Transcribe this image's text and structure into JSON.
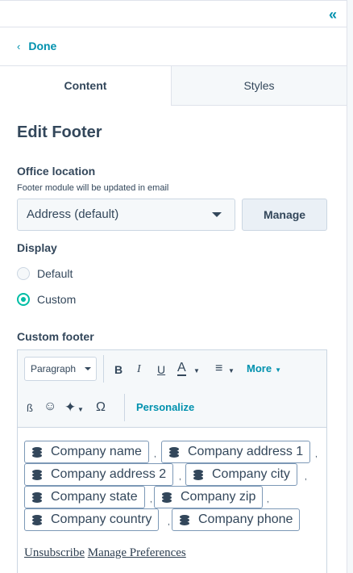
{
  "header": {
    "collapse_icon": "«"
  },
  "nav": {
    "done_label": "Done",
    "chevron": "‹"
  },
  "tabs": [
    {
      "label": "Content",
      "active": true
    },
    {
      "label": "Styles",
      "active": false
    }
  ],
  "panel": {
    "title": "Edit Footer",
    "office_location": {
      "label": "Office location",
      "help": "Footer module will be updated in email",
      "selected": "Address (default)",
      "manage_label": "Manage"
    },
    "display": {
      "label": "Display",
      "options": [
        {
          "label": "Default",
          "checked": false
        },
        {
          "label": "Custom",
          "checked": true
        }
      ]
    },
    "custom_footer": {
      "label": "Custom footer",
      "toolbar": {
        "paragraph": "Paragraph",
        "bold": "B",
        "italic": "I",
        "underline": "U",
        "text_color": "A",
        "align": "≡",
        "more": "More",
        "emoji": "☺",
        "omega": "Ω",
        "personalize": "Personalize"
      },
      "tokens": [
        "Company name",
        "Company address 1",
        "Company address 2",
        "Company city",
        "Company state",
        "Company zip",
        "Company country",
        "Company phone"
      ],
      "links": {
        "unsubscribe": "Unsubscribe",
        "manage_preferences": "Manage Preferences"
      }
    }
  },
  "colors": {
    "accent": "#0091ae",
    "text": "#33475b",
    "radio": "#00bda5"
  }
}
